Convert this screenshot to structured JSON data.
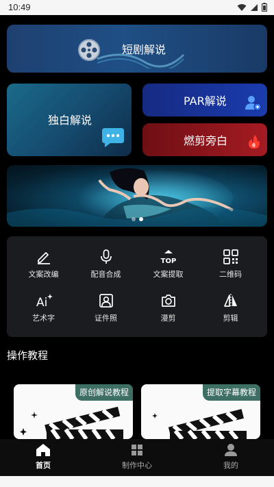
{
  "status_bar": {
    "time": "10:49"
  },
  "feature_cards": {
    "drama": "短剧解说",
    "monologue": "独白解说",
    "par": "PAR解说",
    "burn": "燃剪旁白"
  },
  "carousel": {
    "count": 2,
    "active": 1
  },
  "tools": [
    {
      "label": "文案改编",
      "icon": "pencil-icon"
    },
    {
      "label": "配音合成",
      "icon": "microphone-icon"
    },
    {
      "label": "文案提取",
      "icon": "top-icon"
    },
    {
      "label": "二维码",
      "icon": "qr-code-icon"
    },
    {
      "label": "艺术字",
      "icon": "ai-text-icon"
    },
    {
      "label": "证件照",
      "icon": "id-photo-icon"
    },
    {
      "label": "漫剪",
      "icon": "camera-icon"
    },
    {
      "label": "剪辑",
      "icon": "flip-icon"
    }
  ],
  "tutorials": {
    "title": "操作教程",
    "items": [
      {
        "tag": "原创解说教程"
      },
      {
        "tag": "提取字幕教程"
      }
    ]
  },
  "bottom_nav": [
    {
      "label": "首页",
      "icon": "home-icon",
      "active": true
    },
    {
      "label": "制作中心",
      "icon": "grid-icon",
      "active": false
    },
    {
      "label": "我的",
      "icon": "person-icon",
      "active": false
    }
  ]
}
